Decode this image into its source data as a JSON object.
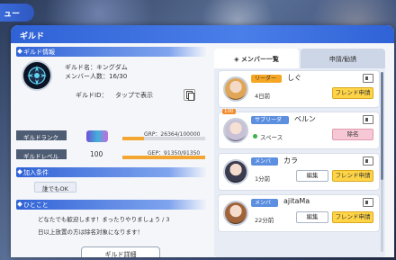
{
  "menu_tab": {
    "label": "ュー"
  },
  "header": {
    "title": "ギルド"
  },
  "guild_info": {
    "section_title": "ギルド情報",
    "name_label": "ギルド名：キングダム",
    "members_label": "メンバー人数：16/30",
    "id_label": "ギルドID：",
    "id_value": "タップで表示"
  },
  "stats": {
    "rank_label": "ギルドランク",
    "grp_text": "GRP：26364/100000",
    "grp_progress": 0.2636,
    "level_label": "ギルドレベル",
    "level_value": "100",
    "gep_text": "GEP：91350/91350",
    "gep_progress": 1.0
  },
  "join": {
    "section_title": "加入条件",
    "condition": "誰でもOK"
  },
  "message": {
    "section_title": "ひとこと",
    "line1": "どなたでも歓迎します！まったりやりましょう / 3",
    "line2": "日以上放置の方は除名対象になります！"
  },
  "detail_button": "ギルド詳細",
  "tabs": {
    "members": "メンバー一覧",
    "requests": "申請/勧誘"
  },
  "members": [
    {
      "role": "リーダー",
      "name": "しぐ",
      "time": "4日前",
      "action": "フレンド申請",
      "role_type": "leader"
    },
    {
      "role": "サブリーダー",
      "name": "ベルン",
      "time": "スペース",
      "action": "除名",
      "role_type": "sub",
      "badge": "100"
    },
    {
      "role": "メンバー",
      "name": "カラ",
      "time": "1分前",
      "edit": "編集",
      "action": "フレンド申請",
      "role_type": "member"
    },
    {
      "role": "メンバー",
      "name": "ajitaMa",
      "time": "22分前",
      "edit": "編集",
      "action": "フレンド申請",
      "role_type": "member"
    }
  ]
}
